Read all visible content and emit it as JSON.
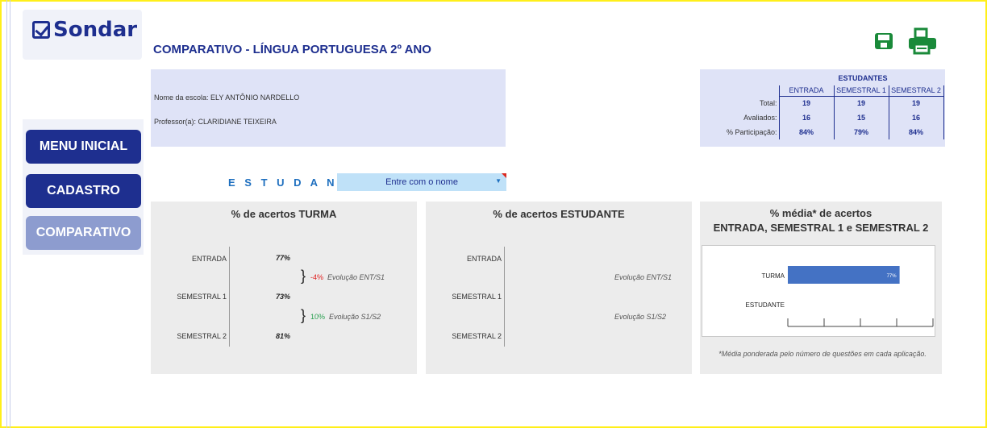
{
  "app": {
    "logo_text": "Sondar"
  },
  "page": {
    "title": "COMPARATIVO - LÍNGUA PORTUGUESA 2º ANO"
  },
  "toolbar": {
    "save_icon": "floppy-disk-icon",
    "print_icon": "printer-icon"
  },
  "nav": {
    "menu_inicial": "MENU INICIAL",
    "cadastro": "CADASTRO",
    "comparativo": "COMPARATIVO"
  },
  "school": {
    "name_line": "Nome da escola: ELY ANTÔNIO NARDELLO",
    "teacher_line": "Professor(a): CLARIDIANE TEIXEIRA"
  },
  "stats": {
    "header": "ESTUDANTES",
    "columns": [
      "ENTRADA",
      "SEMESTRAL 1",
      "SEMESTRAL 2"
    ],
    "rows": [
      {
        "label": "Total:",
        "values": [
          "19",
          "19",
          "19"
        ]
      },
      {
        "label": "Avaliados:",
        "values": [
          "16",
          "15",
          "16"
        ]
      },
      {
        "label": "% Participação:",
        "values": [
          "84%",
          "79%",
          "84%"
        ]
      }
    ]
  },
  "student_selector": {
    "label": "E S T U D A N T E ►",
    "value": "Entre com o nome"
  },
  "turma_panel": {
    "title": "% de acertos TURMA",
    "rows": [
      {
        "label": "ENTRADA",
        "value": "77%"
      },
      {
        "label": "SEMESTRAL 1",
        "value": "73%"
      },
      {
        "label": "SEMESTRAL 2",
        "value": "81%"
      }
    ],
    "evolutions": [
      {
        "value": "-4%",
        "label": "Evolução ENT/S1"
      },
      {
        "value": "10%",
        "label": "Evolução S1/S2"
      }
    ]
  },
  "estudante_panel": {
    "title": "% de acertos ESTUDANTE",
    "rows": [
      {
        "label": "ENTRADA"
      },
      {
        "label": "SEMESTRAL 1"
      },
      {
        "label": "SEMESTRAL 2"
      }
    ],
    "evolutions": [
      {
        "label": "Evolução ENT/S1"
      },
      {
        "label": "Evolução S1/S2"
      }
    ]
  },
  "media_panel": {
    "title_line1": "% média* de acertos",
    "title_line2": "ENTRADA, SEMESTRAL 1 e SEMESTRAL 2",
    "note": "*Média ponderada pelo número de questões em cada aplicação."
  },
  "chart_data": {
    "type": "bar",
    "orientation": "horizontal",
    "categories": [
      "TURMA",
      "ESTUDANTE"
    ],
    "values": [
      77,
      null
    ],
    "data_labels": [
      "77%",
      ""
    ],
    "xlim": [
      0,
      100
    ],
    "color": "#4472c4"
  }
}
